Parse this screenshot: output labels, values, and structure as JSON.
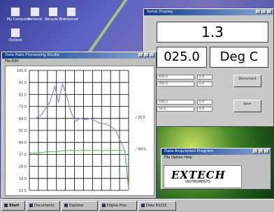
{
  "desktop": {
    "icons": [
      {
        "label": "My Computer"
      },
      {
        "label": "Network"
      },
      {
        "label": "Recycle Bin"
      },
      {
        "label": "Internet"
      },
      {
        "label": "Outlook"
      }
    ]
  },
  "graph_window": {
    "title": "Data Rate Processing Studio",
    "menu": "File  Edit",
    "y_ticks": [
      "100.0",
      "91.0",
      "82.0",
      "73.0",
      "64.0",
      "55.0",
      "46.0",
      "37.0",
      "28.0",
      "19.0",
      "10.0"
    ],
    "right_label_top": "DCV",
    "right_label_bottom": "RH%"
  },
  "chart_data": {
    "type": "line",
    "ylim": [
      10,
      100
    ],
    "series": [
      {
        "name": "DCV",
        "color": "#8a8ad8",
        "x": [
          0,
          10,
          18,
          26,
          32,
          40,
          46,
          52,
          58,
          66,
          72,
          80,
          88,
          96,
          104,
          112,
          120,
          128,
          136,
          142,
          150,
          156
        ],
        "values": [
          64,
          64,
          66,
          72,
          76,
          88,
          76,
          90,
          82,
          68,
          62,
          64,
          63,
          64,
          62,
          60,
          60,
          58,
          55,
          48,
          40,
          10
        ]
      },
      {
        "name": "RH%",
        "color": "#60c060",
        "x": [
          0,
          14,
          28,
          42,
          56,
          70,
          84,
          98,
          112,
          126,
          140,
          150,
          156
        ],
        "values": [
          38,
          38,
          39,
          39,
          40,
          40,
          40,
          40,
          40,
          40,
          40,
          40,
          12
        ]
      }
    ],
    "x_count": 11
  },
  "reading_window": {
    "title": "Serial Display",
    "value": "1.3",
    "reading": "025.0",
    "unit": "Deg C",
    "fields": [
      "400.0",
      "350.0",
      "100.0",
      "50.0"
    ],
    "field_small": [
      "0.0",
      "0.0",
      "0.0",
      "0.0"
    ],
    "button1": "Disconnect",
    "button2": "Save"
  },
  "extech_window": {
    "title": "Data Acquisition Program",
    "menu": "File  Option  Help",
    "logo": "EXTECH",
    "logo_sub": "INSTRUMENTS"
  },
  "taskbar": {
    "start": "Start",
    "tasks": [
      "Documents",
      "Explorer",
      "Digital Proc",
      "Data RS232"
    ]
  }
}
